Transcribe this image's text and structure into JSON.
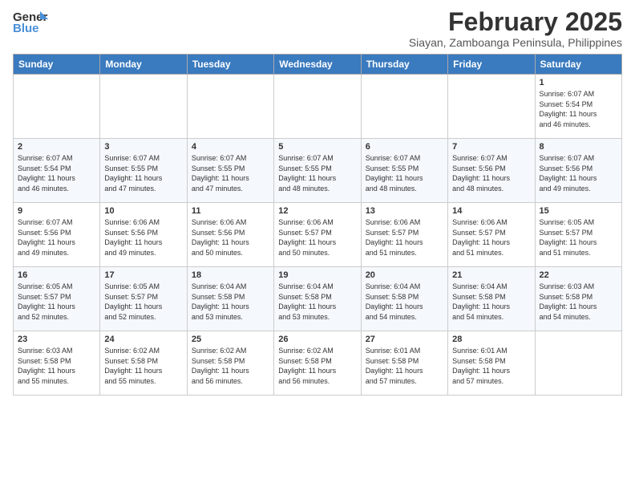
{
  "header": {
    "logo_line1": "General",
    "logo_line2": "Blue",
    "title": "February 2025",
    "subtitle": "Siayan, Zamboanga Peninsula, Philippines"
  },
  "days_of_week": [
    "Sunday",
    "Monday",
    "Tuesday",
    "Wednesday",
    "Thursday",
    "Friday",
    "Saturday"
  ],
  "weeks": [
    [
      {
        "day": "",
        "info": ""
      },
      {
        "day": "",
        "info": ""
      },
      {
        "day": "",
        "info": ""
      },
      {
        "day": "",
        "info": ""
      },
      {
        "day": "",
        "info": ""
      },
      {
        "day": "",
        "info": ""
      },
      {
        "day": "1",
        "info": "Sunrise: 6:07 AM\nSunset: 5:54 PM\nDaylight: 11 hours\nand 46 minutes."
      }
    ],
    [
      {
        "day": "2",
        "info": "Sunrise: 6:07 AM\nSunset: 5:54 PM\nDaylight: 11 hours\nand 46 minutes."
      },
      {
        "day": "3",
        "info": "Sunrise: 6:07 AM\nSunset: 5:55 PM\nDaylight: 11 hours\nand 47 minutes."
      },
      {
        "day": "4",
        "info": "Sunrise: 6:07 AM\nSunset: 5:55 PM\nDaylight: 11 hours\nand 47 minutes."
      },
      {
        "day": "5",
        "info": "Sunrise: 6:07 AM\nSunset: 5:55 PM\nDaylight: 11 hours\nand 48 minutes."
      },
      {
        "day": "6",
        "info": "Sunrise: 6:07 AM\nSunset: 5:55 PM\nDaylight: 11 hours\nand 48 minutes."
      },
      {
        "day": "7",
        "info": "Sunrise: 6:07 AM\nSunset: 5:56 PM\nDaylight: 11 hours\nand 48 minutes."
      },
      {
        "day": "8",
        "info": "Sunrise: 6:07 AM\nSunset: 5:56 PM\nDaylight: 11 hours\nand 49 minutes."
      }
    ],
    [
      {
        "day": "9",
        "info": "Sunrise: 6:07 AM\nSunset: 5:56 PM\nDaylight: 11 hours\nand 49 minutes."
      },
      {
        "day": "10",
        "info": "Sunrise: 6:06 AM\nSunset: 5:56 PM\nDaylight: 11 hours\nand 49 minutes."
      },
      {
        "day": "11",
        "info": "Sunrise: 6:06 AM\nSunset: 5:56 PM\nDaylight: 11 hours\nand 50 minutes."
      },
      {
        "day": "12",
        "info": "Sunrise: 6:06 AM\nSunset: 5:57 PM\nDaylight: 11 hours\nand 50 minutes."
      },
      {
        "day": "13",
        "info": "Sunrise: 6:06 AM\nSunset: 5:57 PM\nDaylight: 11 hours\nand 51 minutes."
      },
      {
        "day": "14",
        "info": "Sunrise: 6:06 AM\nSunset: 5:57 PM\nDaylight: 11 hours\nand 51 minutes."
      },
      {
        "day": "15",
        "info": "Sunrise: 6:05 AM\nSunset: 5:57 PM\nDaylight: 11 hours\nand 51 minutes."
      }
    ],
    [
      {
        "day": "16",
        "info": "Sunrise: 6:05 AM\nSunset: 5:57 PM\nDaylight: 11 hours\nand 52 minutes."
      },
      {
        "day": "17",
        "info": "Sunrise: 6:05 AM\nSunset: 5:57 PM\nDaylight: 11 hours\nand 52 minutes."
      },
      {
        "day": "18",
        "info": "Sunrise: 6:04 AM\nSunset: 5:58 PM\nDaylight: 11 hours\nand 53 minutes."
      },
      {
        "day": "19",
        "info": "Sunrise: 6:04 AM\nSunset: 5:58 PM\nDaylight: 11 hours\nand 53 minutes."
      },
      {
        "day": "20",
        "info": "Sunrise: 6:04 AM\nSunset: 5:58 PM\nDaylight: 11 hours\nand 54 minutes."
      },
      {
        "day": "21",
        "info": "Sunrise: 6:04 AM\nSunset: 5:58 PM\nDaylight: 11 hours\nand 54 minutes."
      },
      {
        "day": "22",
        "info": "Sunrise: 6:03 AM\nSunset: 5:58 PM\nDaylight: 11 hours\nand 54 minutes."
      }
    ],
    [
      {
        "day": "23",
        "info": "Sunrise: 6:03 AM\nSunset: 5:58 PM\nDaylight: 11 hours\nand 55 minutes."
      },
      {
        "day": "24",
        "info": "Sunrise: 6:02 AM\nSunset: 5:58 PM\nDaylight: 11 hours\nand 55 minutes."
      },
      {
        "day": "25",
        "info": "Sunrise: 6:02 AM\nSunset: 5:58 PM\nDaylight: 11 hours\nand 56 minutes."
      },
      {
        "day": "26",
        "info": "Sunrise: 6:02 AM\nSunset: 5:58 PM\nDaylight: 11 hours\nand 56 minutes."
      },
      {
        "day": "27",
        "info": "Sunrise: 6:01 AM\nSunset: 5:58 PM\nDaylight: 11 hours\nand 57 minutes."
      },
      {
        "day": "28",
        "info": "Sunrise: 6:01 AM\nSunset: 5:58 PM\nDaylight: 11 hours\nand 57 minutes."
      },
      {
        "day": "",
        "info": ""
      }
    ]
  ]
}
